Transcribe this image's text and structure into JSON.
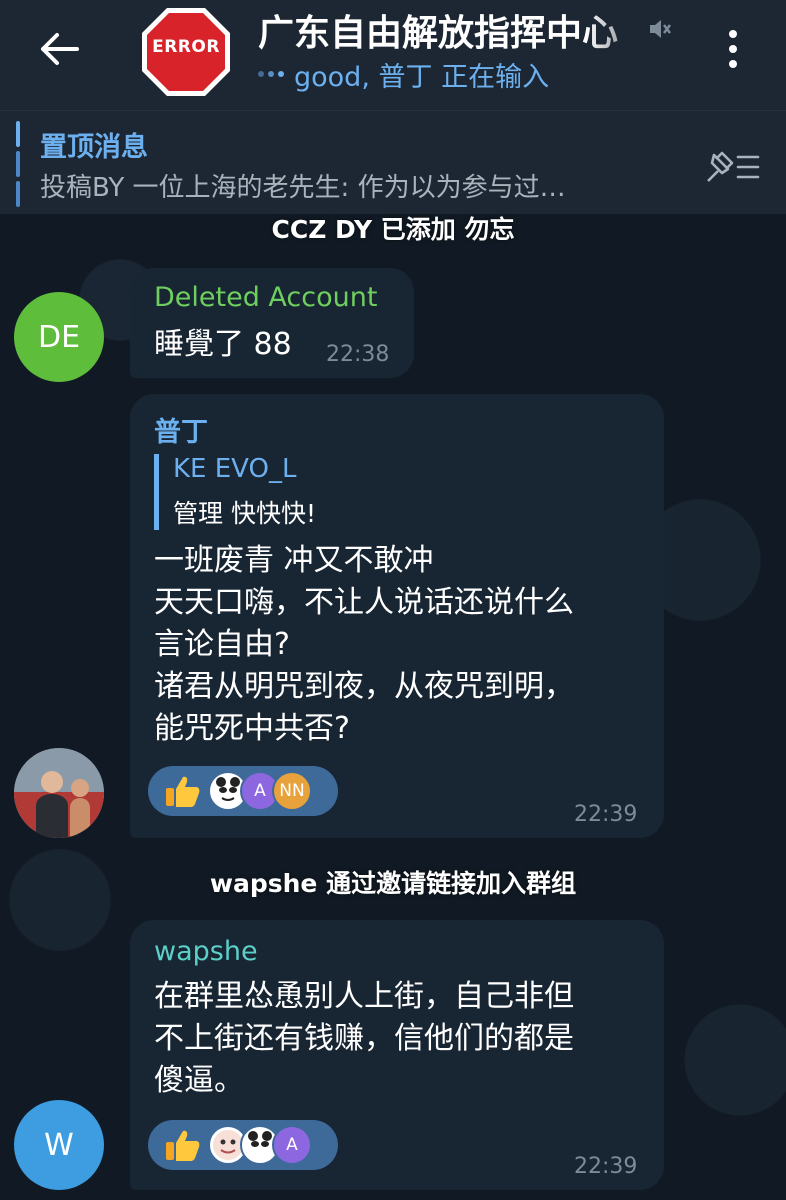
{
  "header": {
    "avatar_text": "ERROR",
    "title": "广东自由解放指挥中心",
    "typing": "good, 普丁 正在输入"
  },
  "pinned": {
    "title": "置顶消息",
    "text": "投稿BY 一位上海的老先生:    作为以为参与过…"
  },
  "service_messages": [
    "CCZ DY 已添加 勿忘",
    "wapshe 通过邀请链接加入群组"
  ],
  "messages": [
    {
      "sender": "Deleted Account",
      "sender_color": "#6fcf5e",
      "avatar_initials": "DE",
      "avatar_color": "#5fbd3c",
      "text": "睡覺了 88",
      "time": "22:38"
    },
    {
      "sender": "普丁",
      "sender_color": "#6cb0ef",
      "reply": {
        "name": "KE EVO_L",
        "text": "管理 快快快!"
      },
      "text": "一班废青 冲又不敢冲\n天天口嗨，不让人说话还说什么\n言论自由?\n诸君从明咒到夜，从夜咒到明，\n能咒死中共否?",
      "reactions": {
        "emoji": "thumbs-up",
        "avatars": [
          "sticker",
          "A",
          "NN"
        ]
      },
      "time": "22:39"
    },
    {
      "sender": "wapshe",
      "sender_color": "#5cd0c8",
      "avatar_initials": "W",
      "avatar_color": "#3d9de0",
      "text": "在群里怂恿别人上街，自己非但\n不上街还有钱赚，信他们的都是\n傻逼。",
      "reactions": {
        "emoji": "thumbs-up",
        "avatars": [
          "sticker",
          "sticker",
          "A"
        ]
      },
      "time": "22:39"
    }
  ],
  "colors": {
    "header_bg": "#1c2733",
    "bubble_bg": "#182533",
    "accent": "#6cb0ef",
    "reaction_bg": "#3e6a9a",
    "error_red": "#d9232a"
  }
}
